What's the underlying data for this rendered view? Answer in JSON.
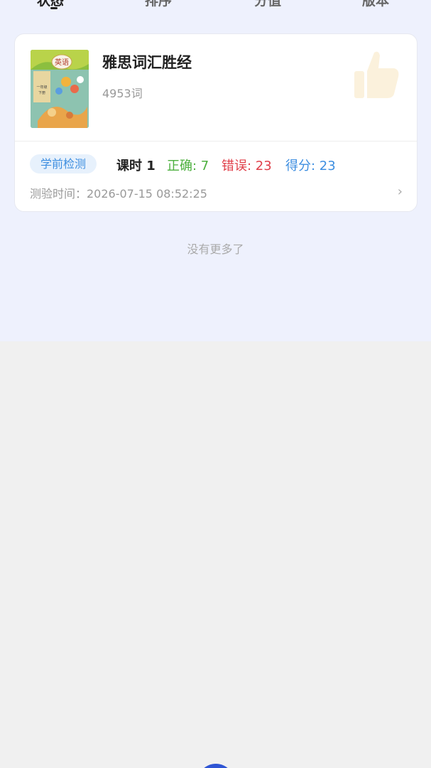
{
  "tabs": [
    {
      "label": "状态"
    },
    {
      "label": "排序"
    },
    {
      "label": "分值"
    },
    {
      "label": "版本"
    }
  ],
  "card": {
    "cover": {
      "title_text": "英语",
      "grade_text": "一年级",
      "volume_text": "下册"
    },
    "title": "雅思词汇胜经",
    "word_count": "4953词",
    "badge": "学前检测",
    "lesson": "课时 1",
    "correct": "正确: 7",
    "wrong": "错误: 23",
    "score": "得分: 23",
    "test_time": "测验时间：2026-07-15 08:52:25",
    "chevron": "›"
  },
  "footer": {
    "no_more": "没有更多了"
  },
  "colors": {
    "top_background": "#eef1fd",
    "page_background": "#f0f0f0",
    "correct": "#4caf3e",
    "wrong": "#e0404a",
    "score": "#3d8ee0",
    "badge_bg": "#e7f1fc",
    "fab": "#2f55d4"
  },
  "icons": {
    "thumb": "thumbs-up-icon",
    "chevron": "chevron-right-icon"
  }
}
